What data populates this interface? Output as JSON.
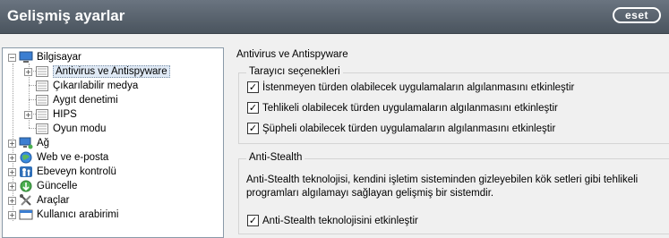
{
  "window": {
    "title": "Gelişmiş ayarlar",
    "logo": "eset"
  },
  "tree": {
    "items": [
      {
        "label": "Bilgisayar",
        "icon": "computer-icon",
        "expanded": true
      },
      {
        "label": "Antivirus ve Antispyware",
        "icon": "list-icon",
        "selected": true
      },
      {
        "label": "Çıkarılabilir medya",
        "icon": "list-icon"
      },
      {
        "label": "Aygıt denetimi",
        "icon": "list-icon"
      },
      {
        "label": "HIPS",
        "icon": "list-icon"
      },
      {
        "label": "Oyun modu",
        "icon": "list-icon"
      },
      {
        "label": "Ağ",
        "icon": "network-icon"
      },
      {
        "label": "Web ve e-posta",
        "icon": "globe-icon"
      },
      {
        "label": "Ebeveyn kontrolü",
        "icon": "parental-icon"
      },
      {
        "label": "Güncelle",
        "icon": "update-icon"
      },
      {
        "label": "Araçlar",
        "icon": "tools-icon"
      },
      {
        "label": "Kullanıcı arabirimi",
        "icon": "ui-icon"
      }
    ]
  },
  "panel": {
    "title": "Antivirus ve Antispyware",
    "scanner_group": {
      "title": "Tarayıcı seçenekleri",
      "options": [
        {
          "label": "İstenmeyen türden olabilecek uygulamaların algılanmasını etkinleştir",
          "checked": true
        },
        {
          "label": "Tehlikeli olabilecek türden uygulamaların algılanmasını etkinleştir",
          "checked": true
        },
        {
          "label": "Şüpheli olabilecek türden uygulamaların algılanmasını etkinleştir",
          "checked": true
        }
      ]
    },
    "antistealth_group": {
      "title": "Anti-Stealth",
      "description_line1": "Anti-Stealth teknolojisi, kendini işletim sisteminden gizleyebilen kök setleri gibi tehlikeli",
      "description_line2": "programları algılamayı sağlayan gelişmiş bir sistemdir.",
      "option": {
        "label": "Anti-Stealth teknolojisini etkinleştir",
        "checked": true
      }
    }
  },
  "colors": {
    "titlebar": "#5a636d",
    "selection": "#dfe9f5"
  }
}
